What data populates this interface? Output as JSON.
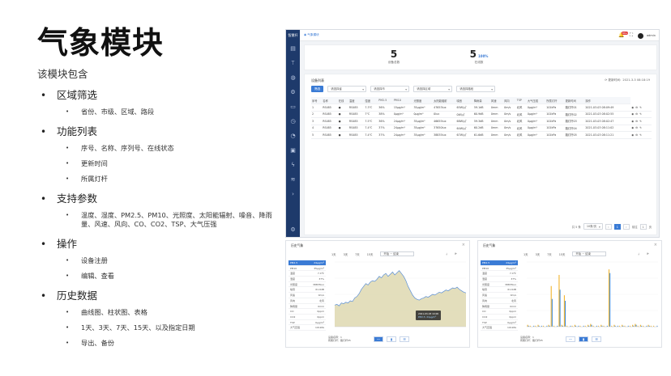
{
  "slide": {
    "title": "气象模块",
    "intro": "该模块包含",
    "sections": [
      {
        "heading": "区域筛选",
        "items": [
          "省份、市级、区域、路段"
        ]
      },
      {
        "heading": "功能列表",
        "items": [
          "序号、名称、序列号、在线状态",
          "更新时间",
          "所属灯杆"
        ]
      },
      {
        "heading": "支持参数",
        "items": [
          "温度、湿度、PM2.5、PM10、光照度、太阳能辐射、噪音、降雨量、风速、风向、CO、CO2、TSP、大气压强"
        ]
      },
      {
        "heading": "操作",
        "items": [
          "设备注册",
          "编辑、查看"
        ]
      },
      {
        "heading": "历史数据",
        "items": [
          "曲线图、柱状图、表格",
          "1天、3天、7天、15天、以及指定日期",
          "导出、备份"
        ]
      }
    ]
  },
  "app": {
    "brand": "智慧杆",
    "breadcrumb": "◉ 气象模块",
    "notification_count": "99+",
    "user_name": "admin",
    "stats": [
      {
        "value": "5",
        "label": "设备总数",
        "percent": ""
      },
      {
        "value": "5",
        "label": "在线数",
        "percent": "100%"
      }
    ],
    "panel_title": "设备列表",
    "updated": "更新时间：2021-3-3 08:18:19",
    "filter_button": "筛选",
    "filters": [
      "请选择省",
      "请选择市",
      "请选择区域",
      "请选择路段"
    ],
    "columns": [
      "序号",
      "名称",
      "在线",
      "温度",
      "湿度",
      "PM2.5",
      "PM10",
      "光照度",
      "太阳能辐射",
      "噪音",
      "降雨量",
      "风速",
      "风向",
      "TSP",
      "大气压强",
      "所属灯杆",
      "更新时间",
      "操作"
    ],
    "rows": [
      [
        "1",
        "RS485",
        "●",
        "RS485",
        "7.3℃",
        "36%",
        "15μg/m³",
        "35μg/m³",
        "47653lux",
        "65W/㎡",
        "59.1dB",
        "0mm",
        "0m/s",
        "北风",
        "0μg/m³",
        "101kPa",
        "路灯杆01",
        "2021-03-03 08:09:49"
      ],
      [
        "2",
        "RS485",
        "●",
        "RS485",
        "7℃",
        "38%",
        "0μg/m³",
        "0μg/m³",
        "0lux",
        "0W/㎡",
        "60.9dB",
        "0mm",
        "0m/s",
        "北风",
        "0μg/m³",
        "101kPa",
        "路灯杆02",
        "2021-03-03 08:02:55"
      ],
      [
        "3",
        "RS485",
        "●",
        "RS485",
        "7.5℃",
        "36%",
        "24μg/m³",
        "35μg/m³",
        "46655lux",
        "68W/㎡",
        "59.3dB",
        "0mm",
        "0m/s",
        "北风",
        "0μg/m³",
        "101kPa",
        "路灯杆03",
        "2021-03-03 08:02:47"
      ],
      [
        "4",
        "RS485",
        "●",
        "RS485",
        "7.4℃",
        "37%",
        "24μg/m³",
        "35μg/m³",
        "37650lux",
        "64W/㎡",
        "60.2dB",
        "0mm",
        "0m/s",
        "北风",
        "0μg/m³",
        "101kPa",
        "路灯杆04",
        "2021-03-03 08:11:02"
      ],
      [
        "5",
        "RS485",
        "●",
        "RS485",
        "7.4℃",
        "37%",
        "24μg/m³",
        "35μg/m³",
        "38835lux",
        "67W/㎡",
        "61.6dB",
        "0mm",
        "0m/s",
        "北风",
        "0μg/m³",
        "101kPa",
        "路灯杆05",
        "2021-03-03 08:11:21"
      ]
    ],
    "total": "共 5 条",
    "page_size": "10条/页",
    "current_page": "1",
    "goto": "前往",
    "page_suffix": "页"
  },
  "chart_line": {
    "title": "历史气象",
    "tabs": [
      "1天",
      "3天",
      "7天",
      "15天"
    ],
    "date_range": "开始 ~ 结束",
    "list": [
      {
        "name": "PM2.5",
        "value": "24μg/m³"
      },
      {
        "name": "PM10",
        "value": "35μg/m³"
      },
      {
        "name": "温度",
        "value": "7.4℃"
      },
      {
        "name": "湿度",
        "value": "37%"
      },
      {
        "name": "光照度",
        "value": "38835lux"
      },
      {
        "name": "噪音",
        "value": "61.6dB"
      },
      {
        "name": "风速",
        "value": "0m/s"
      },
      {
        "name": "风向",
        "value": "北风"
      },
      {
        "name": "降雨量",
        "value": "0mm"
      },
      {
        "name": "CO",
        "value": "0ppm"
      },
      {
        "name": "CO2",
        "value": "0ppm"
      },
      {
        "name": "TSP",
        "value": "0μg/m³"
      },
      {
        "name": "大气压强",
        "value": "101kPa"
      }
    ],
    "tooltip": {
      "time": "2021-03-03 10:00",
      "series": "PM2.5",
      "value": "24μg/m³"
    },
    "footer_1": "设备名称：1",
    "footer_2": "所属灯杆：路灯杆05"
  },
  "chart_bar": {
    "title": "历史气象",
    "tabs": [
      "1天",
      "3天",
      "7天",
      "15天"
    ],
    "date_range": "开始 ~ 结束",
    "list": [
      {
        "name": "PM2.5",
        "value": "24μg/m³"
      },
      {
        "name": "PM10",
        "value": "35μg/m³"
      },
      {
        "name": "温度",
        "value": "7.4℃"
      },
      {
        "name": "湿度",
        "value": "37%"
      },
      {
        "name": "光照度",
        "value": "38835lux"
      },
      {
        "name": "噪音",
        "value": "61.6dB"
      },
      {
        "name": "风速",
        "value": "0m/s"
      },
      {
        "name": "风向",
        "value": "北风"
      },
      {
        "name": "降雨量",
        "value": "0mm"
      },
      {
        "name": "CO",
        "value": "0ppm"
      },
      {
        "name": "CO2",
        "value": "0ppm"
      },
      {
        "name": "TSP",
        "value": "0μg/m³"
      },
      {
        "name": "大气压强",
        "value": "101kPa"
      }
    ],
    "footer_1": "设备名称：1",
    "footer_2": "所属灯杆：路灯杆05"
  },
  "chart_data": [
    {
      "type": "area",
      "series": [
        {
          "values": [
            30,
            31,
            29,
            33,
            32,
            34,
            33,
            36,
            35,
            40,
            42,
            46,
            52,
            56,
            60,
            58,
            62,
            64,
            63,
            66,
            70,
            68,
            72,
            74,
            70,
            73,
            76,
            72,
            75,
            78,
            74,
            70,
            64,
            56,
            50,
            44,
            40,
            38,
            37,
            39,
            40,
            42,
            41,
            43,
            45,
            44,
            46,
            48,
            47,
            49,
            51,
            50,
            52,
            54,
            53,
            55,
            52,
            50,
            48,
            47
          ]
        }
      ],
      "ylim": [
        0,
        90
      ]
    },
    {
      "type": "bar",
      "series": [
        {
          "values": [
            2,
            1,
            0,
            1,
            2,
            0,
            1,
            0,
            2,
            44,
            1,
            0,
            56,
            2,
            34,
            1,
            0,
            1,
            2,
            0,
            1,
            0,
            1,
            2,
            3,
            1,
            0,
            1,
            2,
            1,
            0,
            62,
            1,
            2,
            0,
            1,
            2,
            1,
            0,
            1,
            2,
            3,
            1,
            2,
            1,
            0,
            2,
            1,
            1,
            0
          ]
        },
        {
          "values": [
            1,
            0,
            1,
            0,
            1,
            1,
            0,
            1,
            1,
            30,
            0,
            1,
            40,
            1,
            28,
            0,
            1,
            0,
            1,
            1,
            0,
            1,
            0,
            1,
            2,
            0,
            1,
            0,
            1,
            0,
            1,
            58,
            0,
            1,
            1,
            0,
            1,
            0,
            1,
            0,
            1,
            2,
            0,
            1,
            0,
            1,
            1,
            0,
            0,
            1
          ]
        }
      ],
      "ylim": [
        0,
        70
      ],
      "colors": [
        "#f2b632",
        "#4a90d9"
      ]
    }
  ]
}
